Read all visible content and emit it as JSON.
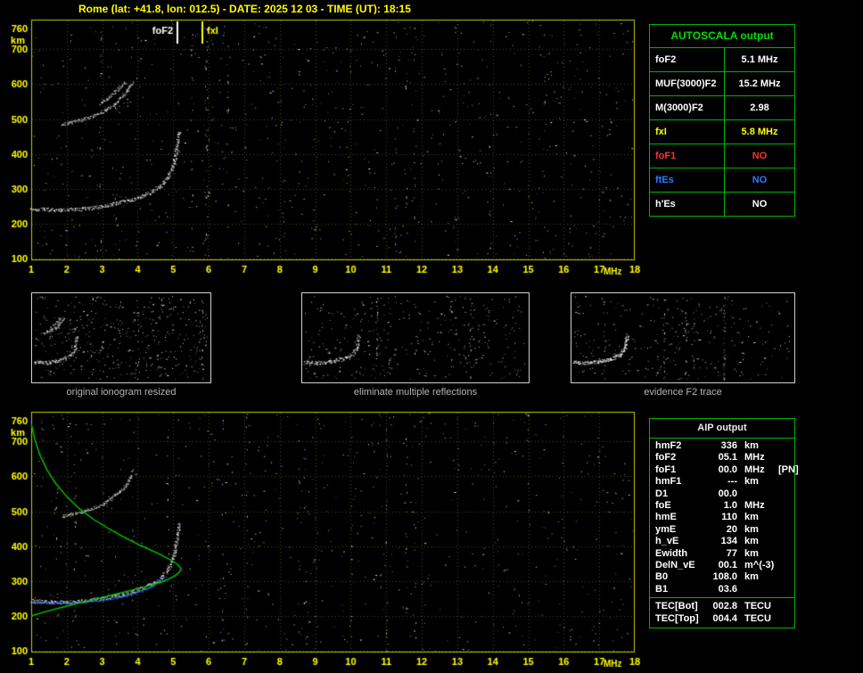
{
  "title": "Rome (lat: +41.8, lon: 012.5) - DATE: 2025 12 03 - TIME (UT): 18:15",
  "colors": {
    "background": "#000000",
    "axis_text": "#ffff00",
    "plot_border": "#c8c800",
    "grid": "#4e4e16",
    "table_border": "#00b400",
    "header_green": "#00dc00",
    "caption_gray": "#b4b4b4",
    "white": "#ffffff",
    "yellow": "#ffff00",
    "red": "#ff3030",
    "blue": "#2e7bff",
    "green": "#00c400"
  },
  "autoscala_table": {
    "header": "AUTOSCALA output",
    "rows": [
      {
        "label": "foF2",
        "value": "5.1 MHz",
        "color": "#ffffff"
      },
      {
        "label": "MUF(3000)F2",
        "value": "15.2 MHz",
        "color": "#ffffff"
      },
      {
        "label": "M(3000)F2",
        "value": "2.98",
        "color": "#ffffff"
      },
      {
        "label": "fxI",
        "value": "5.8 MHz",
        "color": "#ffff00"
      },
      {
        "label": "foF1",
        "value": "NO",
        "color": "#ff3030"
      },
      {
        "label": "ftEs",
        "value": "NO",
        "color": "#2e7bff"
      },
      {
        "label": "h'Es",
        "value": "NO",
        "color": "#ffffff"
      }
    ]
  },
  "aip_table": {
    "header": "AIP output",
    "rows": [
      {
        "label": "hmF2",
        "value": "336",
        "unit": "km",
        "extra": ""
      },
      {
        "label": "foF2",
        "value": "05.1",
        "unit": "MHz",
        "extra": ""
      },
      {
        "label": "foF1",
        "value": "00.0",
        "unit": "MHz",
        "extra": "[PN]"
      },
      {
        "label": "hmF1",
        "value": "---",
        "unit": "km",
        "extra": ""
      },
      {
        "label": "D1",
        "value": "00.0",
        "unit": "",
        "extra": ""
      },
      {
        "label": "foE",
        "value": "1.0",
        "unit": "MHz",
        "extra": ""
      },
      {
        "label": "hmE",
        "value": "110",
        "unit": "km",
        "extra": ""
      },
      {
        "label": "ymE",
        "value": "20",
        "unit": "km",
        "extra": ""
      },
      {
        "label": "h_vE",
        "value": "134",
        "unit": "km",
        "extra": ""
      },
      {
        "label": "Ewidth",
        "value": "77",
        "unit": "km",
        "extra": ""
      },
      {
        "label": "DelN_vE",
        "value": "00.1",
        "unit": "m^(-3)",
        "extra": ""
      },
      {
        "label": "B0",
        "value": "108.0",
        "unit": "km",
        "extra": ""
      },
      {
        "label": "B1",
        "value": "03.6",
        "unit": "",
        "extra": ""
      }
    ],
    "tec_rows": [
      {
        "label": "TEC[Bot]",
        "value": "002.8",
        "unit": "TECU"
      },
      {
        "label": "TEC[Top]",
        "value": "004.4",
        "unit": "TECU"
      }
    ]
  },
  "thumbnails": [
    {
      "caption": "original ionogram resized",
      "noise_count": 420,
      "show_multiples": true,
      "trace_density": 1.5
    },
    {
      "caption": "eliminate multiple reflections",
      "noise_count": 330,
      "show_multiples": false,
      "trace_density": 1.5
    },
    {
      "caption": "evidence F2 trace",
      "noise_count": 280,
      "show_multiples": false,
      "trace_density": 2.5
    }
  ],
  "chart_data": [
    {
      "id": "top_ionogram",
      "type": "scatter",
      "title": "recorded ionogram with autoscaled characteristics",
      "xlabel": "MHz",
      "ylabel": "km",
      "xlim": [
        1,
        18
      ],
      "ylim": [
        95,
        785
      ],
      "xticks": [
        1,
        2,
        3,
        4,
        5,
        6,
        7,
        8,
        9,
        10,
        11,
        12,
        13,
        14,
        15,
        16,
        17,
        18
      ],
      "yticks": [
        100,
        200,
        300,
        400,
        500,
        600,
        700,
        760
      ],
      "grid": true,
      "markers": [
        {
          "label": "foF2",
          "freq": 5.1,
          "color": "#ffffff",
          "side": "left"
        },
        {
          "label": "fxI",
          "freq": 5.8,
          "color": "#ffff00",
          "side": "right"
        }
      ],
      "series": [
        {
          "name": "F2-trace",
          "color": "#ffffff",
          "style": "trace",
          "jpx": 2,
          "points": [
            [
              1.0,
              244
            ],
            [
              1.4,
              241
            ],
            [
              1.8,
              240
            ],
            [
              2.2,
              241
            ],
            [
              2.6,
              245
            ],
            [
              3.0,
              251
            ],
            [
              3.4,
              258
            ],
            [
              3.8,
              268
            ],
            [
              4.1,
              279
            ],
            [
              4.4,
              293
            ],
            [
              4.65,
              310
            ],
            [
              4.82,
              330
            ],
            [
              4.95,
              356
            ],
            [
              5.04,
              390
            ],
            [
              5.1,
              428
            ],
            [
              5.16,
              466
            ]
          ]
        },
        {
          "name": "second-hop-o",
          "color": "#e2e2e2",
          "style": "trace",
          "jpx": 1.6,
          "density": 1.5,
          "points": [
            [
              1.85,
              486
            ],
            [
              2.1,
              491
            ],
            [
              2.4,
              498
            ],
            [
              2.7,
              508
            ],
            [
              3.0,
              521
            ],
            [
              3.25,
              537
            ],
            [
              3.45,
              554
            ],
            [
              3.62,
              572
            ],
            [
              3.75,
              590
            ],
            [
              3.85,
              606
            ]
          ]
        },
        {
          "name": "second-hop-x",
          "color": "#cfcfcf",
          "style": "trace",
          "jpx": 1.4,
          "density": 1.2,
          "points": [
            [
              2.95,
              545
            ],
            [
              3.2,
              565
            ],
            [
              3.45,
              588
            ],
            [
              3.65,
              608
            ]
          ]
        }
      ],
      "noise": {
        "count": 820,
        "streaks": 14,
        "seed": 11
      }
    },
    {
      "id": "bottom_ionogram_with_profile",
      "type": "scatter",
      "title": "ionogram with restored trace and electron density profile",
      "xlabel": "MHz",
      "ylabel": "km",
      "xlim": [
        1,
        18
      ],
      "ylim": [
        95,
        785
      ],
      "xticks": [
        1,
        2,
        3,
        4,
        5,
        6,
        7,
        8,
        9,
        10,
        11,
        12,
        13,
        14,
        15,
        16,
        17,
        18
      ],
      "yticks": [
        100,
        200,
        300,
        400,
        500,
        600,
        700,
        760
      ],
      "grid": true,
      "markers": [],
      "series": [
        {
          "name": "F2-trace",
          "color": "#ffffff",
          "style": "trace",
          "jpx": 2,
          "points": [
            [
              1.0,
              244
            ],
            [
              1.4,
              241
            ],
            [
              1.8,
              240
            ],
            [
              2.2,
              241
            ],
            [
              2.6,
              245
            ],
            [
              3.0,
              251
            ],
            [
              3.4,
              258
            ],
            [
              3.8,
              268
            ],
            [
              4.1,
              279
            ],
            [
              4.4,
              293
            ],
            [
              4.65,
              310
            ],
            [
              4.82,
              330
            ],
            [
              4.95,
              356
            ],
            [
              5.04,
              390
            ],
            [
              5.1,
              428
            ],
            [
              5.16,
              466
            ]
          ]
        },
        {
          "name": "second-hop-o",
          "color": "#e2e2e2",
          "style": "trace",
          "jpx": 1.6,
          "density": 1.5,
          "points": [
            [
              1.85,
              486
            ],
            [
              2.1,
              491
            ],
            [
              2.4,
              498
            ],
            [
              2.7,
              508
            ],
            [
              3.0,
              521
            ],
            [
              3.25,
              537
            ],
            [
              3.45,
              554
            ],
            [
              3.62,
              572
            ],
            [
              3.75,
              590
            ],
            [
              3.85,
              606
            ]
          ]
        },
        {
          "name": "restored-trace",
          "color": "#2e7bff",
          "style": "trace",
          "jpx": 1.2,
          "density": 1.5,
          "points": [
            [
              1.0,
              240
            ],
            [
              1.5,
              238
            ],
            [
              2.0,
              238
            ],
            [
              2.5,
              241
            ],
            [
              3.0,
              246
            ],
            [
              3.4,
              253
            ],
            [
              3.8,
              262
            ],
            [
              4.1,
              272
            ],
            [
              4.4,
              286
            ],
            [
              4.6,
              300
            ],
            [
              4.78,
              315
            ]
          ]
        },
        {
          "name": "electron-density-profile",
          "color": "#00c400",
          "style": "line",
          "points": [
            [
              1.0,
              752
            ],
            [
              1.1,
              706
            ],
            [
              1.25,
              660
            ],
            [
              1.45,
              618
            ],
            [
              1.7,
              578
            ],
            [
              2.0,
              542
            ],
            [
              2.35,
              508
            ],
            [
              2.75,
              477
            ],
            [
              3.2,
              449
            ],
            [
              3.65,
              424
            ],
            [
              4.1,
              401
            ],
            [
              4.55,
              380
            ],
            [
              4.9,
              362
            ],
            [
              5.12,
              348
            ],
            [
              5.22,
              336
            ],
            [
              5.18,
              326
            ],
            [
              5.05,
              315
            ],
            [
              4.85,
              304
            ],
            [
              4.55,
              293
            ],
            [
              4.2,
              283
            ],
            [
              3.8,
              273
            ],
            [
              3.4,
              263
            ],
            [
              3.0,
              253
            ],
            [
              2.6,
              243
            ],
            [
              2.2,
              233
            ],
            [
              1.85,
              224
            ],
            [
              1.55,
              216
            ],
            [
              1.3,
              209
            ],
            [
              1.1,
              203
            ],
            [
              1.0,
              200
            ]
          ]
        }
      ],
      "noise": {
        "count": 700,
        "streaks": 12,
        "seed": 23
      }
    }
  ]
}
